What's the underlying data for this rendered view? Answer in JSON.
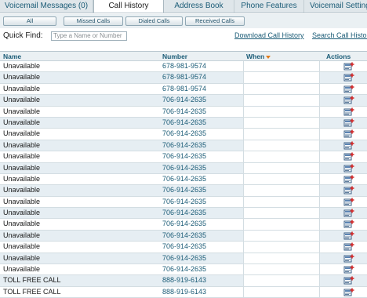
{
  "tabs": [
    {
      "label": "Voicemail Messages (0)",
      "active": false
    },
    {
      "label": "Call History",
      "active": true
    },
    {
      "label": "Address Book",
      "active": false
    },
    {
      "label": "Phone Features",
      "active": false
    },
    {
      "label": "Voicemail Settings",
      "active": false
    }
  ],
  "filters": {
    "all": "All",
    "missed": "Missed Calls",
    "dialed": "Dialed Calls",
    "received": "Received Calls"
  },
  "quick_find": {
    "label": "Quick Find:",
    "placeholder": "Type a Name or Number"
  },
  "links": {
    "download": "Download Call History",
    "search": "Search Call History"
  },
  "table": {
    "headers": {
      "name": "Name",
      "number": "Number",
      "when": "When",
      "actions": "Actions"
    },
    "action_icon": "add-contact-icon",
    "rows": [
      {
        "name": "Unavailable",
        "number": "678-981-9574"
      },
      {
        "name": "Unavailable",
        "number": "678-981-9574"
      },
      {
        "name": "Unavailable",
        "number": "678-981-9574"
      },
      {
        "name": "Unavailable",
        "number": "706-914-2635"
      },
      {
        "name": "Unavailable",
        "number": "706-914-2635"
      },
      {
        "name": "Unavailable",
        "number": "706-914-2635"
      },
      {
        "name": "Unavailable",
        "number": "706-914-2635"
      },
      {
        "name": "Unavailable",
        "number": "706-914-2635"
      },
      {
        "name": "Unavailable",
        "number": "706-914-2635"
      },
      {
        "name": "Unavailable",
        "number": "706-914-2635"
      },
      {
        "name": "Unavailable",
        "number": "706-914-2635"
      },
      {
        "name": "Unavailable",
        "number": "706-914-2635"
      },
      {
        "name": "Unavailable",
        "number": "706-914-2635"
      },
      {
        "name": "Unavailable",
        "number": "706-914-2635"
      },
      {
        "name": "Unavailable",
        "number": "706-914-2635"
      },
      {
        "name": "Unavailable",
        "number": "706-914-2635"
      },
      {
        "name": "Unavailable",
        "number": "706-914-2635"
      },
      {
        "name": "Unavailable",
        "number": "706-914-2635"
      },
      {
        "name": "Unavailable",
        "number": "706-914-2635"
      },
      {
        "name": "TOLL FREE CALL",
        "number": "888-919-6143"
      },
      {
        "name": "TOLL FREE CALL",
        "number": "888-919-6143"
      }
    ]
  },
  "colors": {
    "link": "#1b5c77",
    "row_alt": "#e6eef3",
    "sort_arrow": "#e07b1a"
  }
}
